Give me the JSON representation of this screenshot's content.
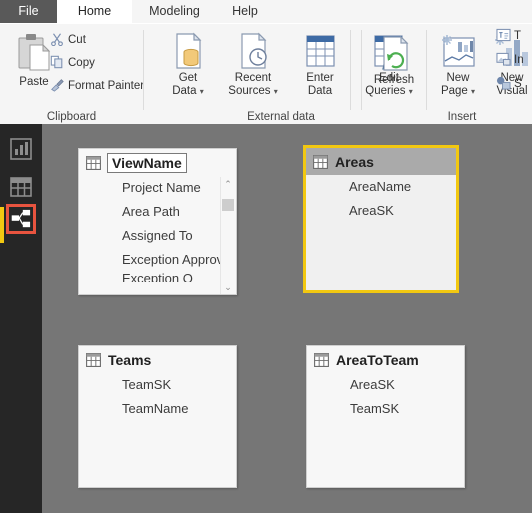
{
  "window": {
    "tabs": [
      {
        "label": "File",
        "id": "file",
        "active": false
      },
      {
        "label": "Home",
        "id": "home",
        "active": true
      },
      {
        "label": "Modeling",
        "id": "modeling",
        "active": false
      },
      {
        "label": "Help",
        "id": "help",
        "active": false
      }
    ]
  },
  "ribbon": {
    "groups": [
      {
        "id": "clipboard",
        "title": "Clipboard"
      },
      {
        "id": "external_data",
        "title": "External data"
      },
      {
        "id": "insert",
        "title": "Insert"
      }
    ],
    "clipboard": {
      "paste_label": "Paste",
      "paste_icon": "paste-icon",
      "cut_label": "Cut",
      "cut_icon": "scissors-icon",
      "copy_label": "Copy",
      "copy_icon": "copy-icon",
      "format_painter_label": "Format Painter",
      "format_painter_icon": "format-painter-icon"
    },
    "external_data": {
      "get_data_line1": "Get",
      "get_data_line2": "Data",
      "get_data_icon": "get-data-icon",
      "recent_sources_line1": "Recent",
      "recent_sources_line2": "Sources",
      "recent_sources_icon": "recent-sources-icon",
      "enter_data_line1": "Enter",
      "enter_data_line2": "Data",
      "enter_data_icon": "enter-data-icon",
      "edit_queries_line1": "Edit",
      "edit_queries_line2": "Queries",
      "edit_queries_icon": "edit-queries-icon",
      "refresh_label": "Refresh",
      "refresh_icon": "refresh-icon",
      "caret": "▾"
    },
    "insert": {
      "new_page_line1": "New",
      "new_page_line2": "Page",
      "new_page_icon": "new-page-icon",
      "new_visual_line1": "New",
      "new_visual_line2": "Visual",
      "new_visual_icon": "new-visual-icon",
      "text_box_label": "T",
      "text_box_icon": "text-box-icon",
      "image_label": "In",
      "image_icon": "image-icon",
      "shapes_label": "S",
      "shapes_icon": "shapes-icon",
      "caret": "▾"
    }
  },
  "sidebar": {
    "items": [
      {
        "id": "report",
        "icon": "report-view-icon",
        "selected": false
      },
      {
        "id": "data",
        "icon": "data-view-icon",
        "selected": false
      },
      {
        "id": "model",
        "icon": "model-view-icon",
        "selected": true
      }
    ],
    "selection_highlight_color": "#e8543f",
    "active_marker_color": "#f2c811"
  },
  "canvas": {
    "background_color": "#767676",
    "selected_card_border_color": "#f2c811",
    "tables": [
      {
        "id": "viewname",
        "name": "ViewName",
        "icon": "table-icon",
        "selected": false,
        "title_in_edit_box": true,
        "has_scrollbar": true,
        "fields": [
          "Project Name",
          "Area Path",
          "Assigned To",
          "Exception Approver"
        ],
        "clipped_field": "Exception O",
        "scrollbar": {
          "up_arrow": "⌃",
          "down_arrow": "⌄"
        }
      },
      {
        "id": "areas",
        "name": "Areas",
        "icon": "table-icon",
        "selected": true,
        "title_in_edit_box": false,
        "has_scrollbar": false,
        "fields": [
          "AreaName",
          "AreaSK"
        ]
      },
      {
        "id": "teams",
        "name": "Teams",
        "icon": "table-icon",
        "selected": false,
        "title_in_edit_box": false,
        "has_scrollbar": false,
        "fields": [
          "TeamSK",
          "TeamName"
        ]
      },
      {
        "id": "areatoteam",
        "name": "AreaToTeam",
        "icon": "table-icon",
        "selected": false,
        "title_in_edit_box": false,
        "has_scrollbar": false,
        "fields": [
          "AreaSK",
          "TeamSK"
        ]
      }
    ]
  }
}
